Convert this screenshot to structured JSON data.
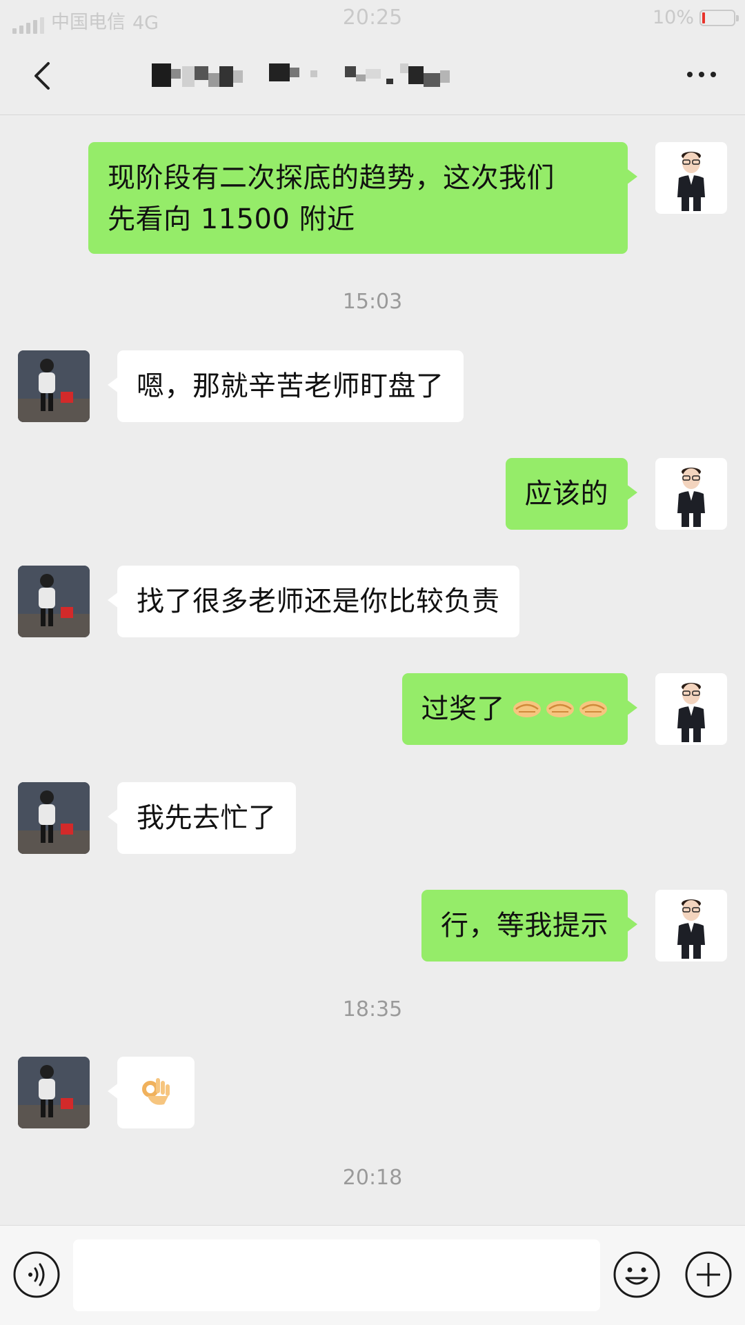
{
  "status_bar": {
    "carrier": "中国电信",
    "network": "4G",
    "time": "20:25",
    "battery": "10%"
  },
  "header": {
    "title": "",
    "back_icon": "chevron-left-icon",
    "more_icon": "more-icon"
  },
  "messages": [
    {
      "from": "me",
      "text": "现阶段有二次探底的趋势，这次我们\n先看向 11500 附近"
    },
    {
      "type": "timestamp",
      "text": "15:03"
    },
    {
      "from": "them",
      "text": "嗯，那就辛苦老师盯盘了"
    },
    {
      "from": "me",
      "text": "应该的"
    },
    {
      "from": "them",
      "text": "找了很多老师还是你比较负责"
    },
    {
      "from": "me",
      "text": "过奖了",
      "emojis": [
        "handshake",
        "handshake",
        "handshake"
      ]
    },
    {
      "from": "them",
      "text": "我先去忙了"
    },
    {
      "from": "me",
      "text": "行，等我提示"
    },
    {
      "type": "timestamp",
      "text": "18:35"
    },
    {
      "from": "them",
      "emoji": "ok-hand"
    },
    {
      "type": "timestamp",
      "text": "20:18"
    }
  ],
  "msg": {
    "m0_line1": "现阶段有二次探底的趋势，这次我们",
    "m0_line2": "先看向 11500 附近",
    "ts1": "15:03",
    "m1": "嗯，那就辛苦老师盯盘了",
    "m2": "应该的",
    "m3": "找了很多老师还是你比较负责",
    "m4": "过奖了",
    "m5": "我先去忙了",
    "m6": "行，等我提示",
    "ts2": "18:35",
    "ts3": "20:18"
  },
  "input_bar": {
    "voice_icon": "voice-icon",
    "emoji_icon": "emoji-icon",
    "plus_icon": "plus-icon",
    "text_value": ""
  },
  "colors": {
    "background": "#ededed",
    "my_bubble": "#95ec69",
    "their_bubble": "#ffffff",
    "timestamp": "#9a9a9a",
    "battery_low": "#e8332b"
  }
}
